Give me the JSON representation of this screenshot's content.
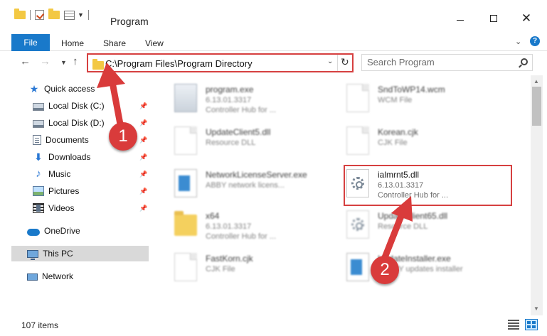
{
  "window": {
    "title": "Program",
    "minimize_icon": "minimize-icon",
    "maximize_icon": "maximize-icon",
    "close_icon": "close-icon"
  },
  "ribbon": {
    "tabs": [
      "File",
      "Home",
      "Share",
      "View"
    ]
  },
  "address": {
    "path": "C:\\Program Files\\Program Directory",
    "search_placeholder": "Search Program"
  },
  "sidebar": {
    "items": [
      {
        "label": "Quick access",
        "icon": "star-icon"
      },
      {
        "label": "Local Disk (C:)",
        "icon": "disk-icon"
      },
      {
        "label": "Local Disk (D:)",
        "icon": "disk-icon"
      },
      {
        "label": "Documents",
        "icon": "document-icon"
      },
      {
        "label": "Downloads",
        "icon": "download-icon"
      },
      {
        "label": "Music",
        "icon": "music-icon"
      },
      {
        "label": "Pictures",
        "icon": "pictures-icon"
      },
      {
        "label": "Videos",
        "icon": "video-icon"
      },
      {
        "label": "OneDrive",
        "icon": "cloud-icon"
      },
      {
        "label": "This PC",
        "icon": "computer-icon"
      },
      {
        "label": "Network",
        "icon": "network-icon"
      }
    ]
  },
  "files": [
    {
      "name": "program.exe",
      "line1": "6.13.01.3317",
      "line2": "Controller Hub for ..."
    },
    {
      "name": "SndToWP14.wcm",
      "line1": "WCM File",
      "line2": ""
    },
    {
      "name": "UpdateClient5.dll",
      "line1": "Resource DLL",
      "line2": ""
    },
    {
      "name": "Korean.cjk",
      "line1": "CJK File",
      "line2": ""
    },
    {
      "name": "NetworkLicenseServer.exe",
      "line1": "ABBY network licens...",
      "line2": ""
    },
    {
      "name": "ialmrnt5.dll",
      "line1": "6.13.01.3317",
      "line2": "Controller Hub for ..."
    },
    {
      "name": "x64",
      "line1": "6.13.01.3317",
      "line2": "Controller Hub for ..."
    },
    {
      "name": "UpdateClient65.dll",
      "line1": "Resource DLL",
      "line2": ""
    },
    {
      "name": "FastKorn.cjk",
      "line1": "CJK File",
      "line2": ""
    },
    {
      "name": "UpdateInstaller.exe",
      "line1": "ABBYY updates installer",
      "line2": ""
    }
  ],
  "status": {
    "item_count": "107 items"
  },
  "annotations": {
    "step1": "1",
    "step2": "2",
    "color": "#d93b3b"
  }
}
